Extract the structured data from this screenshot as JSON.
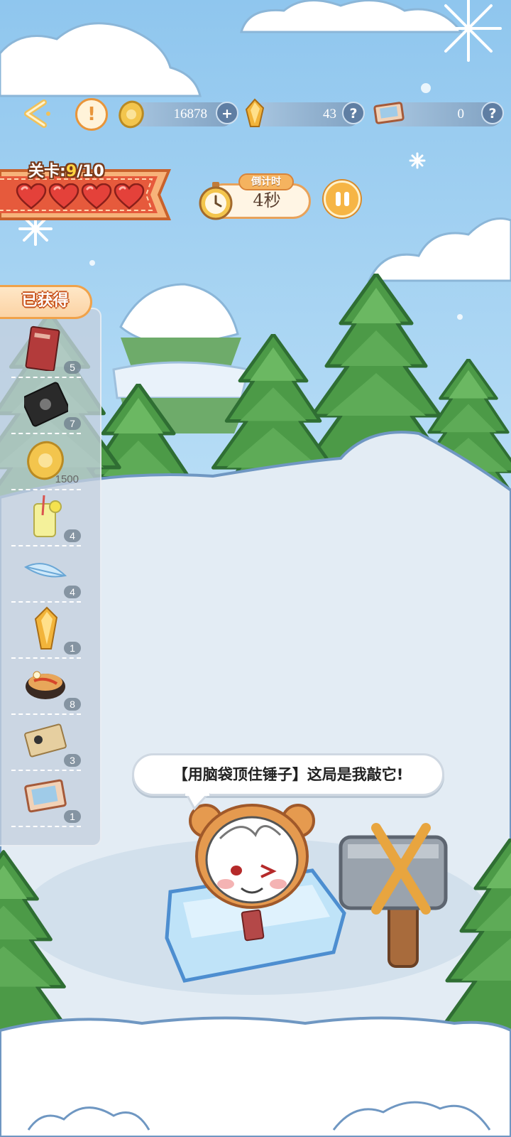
{
  "top_bar": {
    "back_icon": "back-arrow-icon",
    "alert_icon": "exclamation-icon",
    "coins": {
      "icon": "coin-icon",
      "value": "16878",
      "action_icon": "plus-icon"
    },
    "crystals": {
      "icon": "crystal-icon",
      "value": "43",
      "action_icon": "question-icon"
    },
    "tickets": {
      "icon": "ticket-icon",
      "value": "0",
      "action_icon": "question-icon"
    }
  },
  "level": {
    "prefix": "关卡:",
    "current": "9",
    "total_suffix": "/10",
    "lives": 4,
    "life_icon": "heart-icon"
  },
  "timer": {
    "title": "倒计时",
    "value": "4秒",
    "icon": "stopwatch-icon",
    "pause_icon": "pause-icon"
  },
  "obtained": {
    "title": "已获得",
    "items": [
      {
        "icon": "red-book-icon",
        "count": "5"
      },
      {
        "icon": "black-card-icon",
        "count": "7"
      },
      {
        "icon": "gold-coin-icon",
        "count": "1500"
      },
      {
        "icon": "lemonade-icon",
        "count": "4"
      },
      {
        "icon": "feather-icon",
        "count": "4"
      },
      {
        "icon": "crystal-icon",
        "count": "1"
      },
      {
        "icon": "food-bowl-icon",
        "count": "8"
      },
      {
        "icon": "ticket-paper-icon",
        "count": "3"
      },
      {
        "icon": "postcard-icon",
        "count": "1"
      }
    ]
  },
  "speech": "【用脑袋顶住锤子】这局是我敲它!",
  "colors": {
    "sky": "#a9d3f2",
    "snow": "#e4edf5",
    "tree": "#4e9a49",
    "accent_orange": "#f0a24a",
    "heart": "#e4413a"
  }
}
